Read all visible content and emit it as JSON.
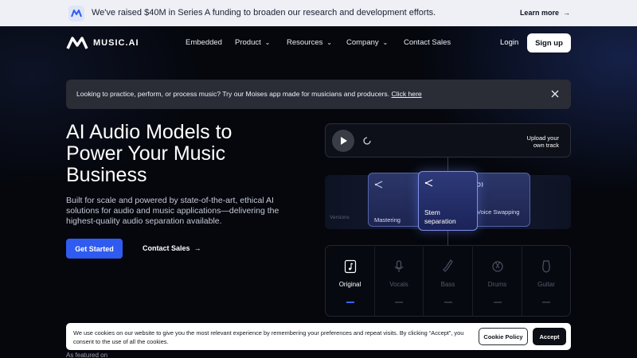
{
  "announcement": {
    "message": "We've raised $40M in Series A funding to broaden our research and development efforts.",
    "link_label": "Learn more",
    "link_icon": "arrow-right-icon"
  },
  "header": {
    "brand": "MUSIC.AI",
    "nav": [
      {
        "label": "Embedded",
        "has_dropdown": false
      },
      {
        "label": "Product",
        "has_dropdown": true
      },
      {
        "label": "Resources",
        "has_dropdown": true
      },
      {
        "label": "Company",
        "has_dropdown": true
      },
      {
        "label": "Contact Sales",
        "has_dropdown": false
      }
    ],
    "login": "Login",
    "signup": "Sign up"
  },
  "info_banner": {
    "text": "Looking to practice, perform, or process music? Try our Moises app made for musicians and producers.",
    "link": "Click here",
    "close_icon": "close-icon"
  },
  "hero": {
    "title_lines": [
      "AI Audio Models to",
      "Power Your Music",
      "Business"
    ],
    "subtitle": "Built for scale and powered by state-of-the-art, ethical AI solutions for audio and music applications—delivering the highest-quality audio separation available.",
    "primary_cta": "Get Started",
    "secondary_cta": "Contact Sales"
  },
  "player": {
    "upload_lines": [
      "Upload your",
      "own track"
    ]
  },
  "processing": {
    "faded_left": "Versions",
    "cards": [
      {
        "label": "Mastering",
        "icon": "share-icon"
      },
      {
        "label": "Stem separation",
        "icon": "share-icon",
        "selected": true
      },
      {
        "label": "Voice Swapping",
        "icon": "voice-icon"
      }
    ]
  },
  "tracks": [
    {
      "label": "Original",
      "icon": "music-note-icon",
      "active": true
    },
    {
      "label": "Vocals",
      "icon": "microphone-icon",
      "active": false
    },
    {
      "label": "Bass",
      "icon": "bass-guitar-icon",
      "active": false
    },
    {
      "label": "Drums",
      "icon": "drum-icon",
      "active": false
    },
    {
      "label": "Guitar",
      "icon": "guitar-icon",
      "active": false
    }
  ],
  "cookie": {
    "text": "We use cookies on our website to give you the most relevant experience by remembering your preferences and repeat visits. By clicking “Accept”, you consent to the use of all the cookies.",
    "policy_label": "Cookie Policy",
    "accept_label": "Accept"
  },
  "featured": "As featured on",
  "colors": {
    "accent_blue": "#2f5bf0",
    "background": "#05070d",
    "announcement_bg": "#eef0f6"
  }
}
